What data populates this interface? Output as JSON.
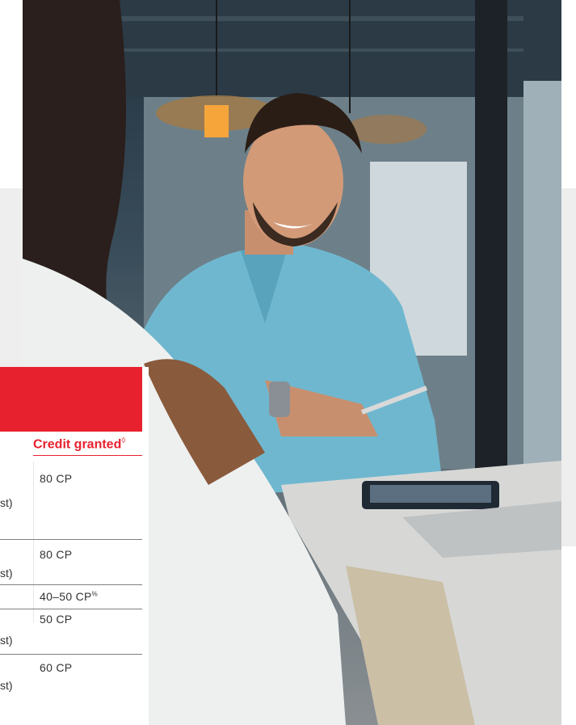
{
  "table": {
    "header": {
      "credit_label": "Credit granted",
      "credit_marker": "◊"
    },
    "rows": [
      {
        "left_fragment": "st)",
        "credit": "80 CP",
        "credit_sup": ""
      },
      {
        "left_fragment": "st)",
        "credit": "80 CP",
        "credit_sup": ""
      },
      {
        "left_fragment": "",
        "credit": "40–50 CP",
        "credit_sup": "%"
      },
      {
        "left_fragment": "st)",
        "credit": "50 CP",
        "credit_sup": ""
      },
      {
        "left_fragment": "st)",
        "credit": "60 CP",
        "credit_sup": ""
      }
    ]
  },
  "colors": {
    "accent_red": "#e8212f",
    "panel_gray": "#eeeeee"
  }
}
